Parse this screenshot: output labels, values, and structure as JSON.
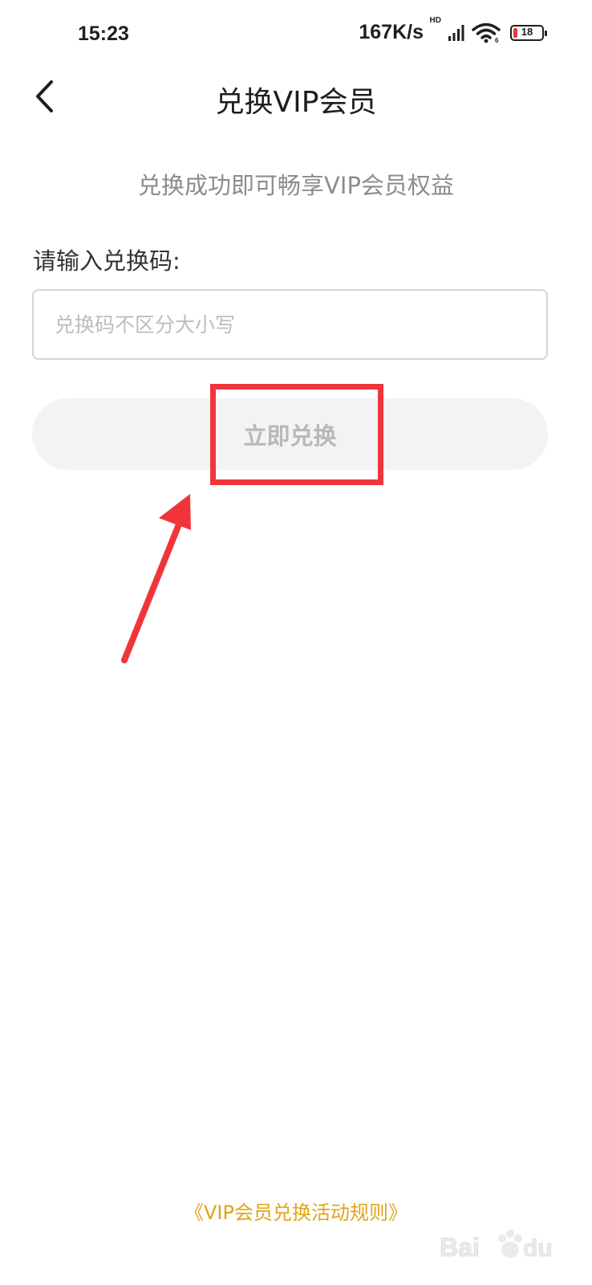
{
  "status_bar": {
    "time": "15:23",
    "net_speed": "167K/s",
    "hd_label": "HD",
    "battery_level": "18",
    "icons": [
      "signal-icon",
      "wifi-icon",
      "battery-icon"
    ]
  },
  "header": {
    "back_icon": "chevron-left-icon",
    "title": "兑换VIP会员"
  },
  "main": {
    "subtitle": "兑换成功即可畅享VIP会员权益",
    "input_label": "请输入兑换码:",
    "code_input": {
      "value": "",
      "placeholder": "兑换码不区分大小写"
    },
    "redeem_button_label": "立即兑换"
  },
  "footer": {
    "rules_link": "《VIP会员兑换活动规则》"
  },
  "colors": {
    "title": "#1e1e1e",
    "subtitle": "#8c8c8c",
    "placeholder": "#bdbdbd",
    "button_bg": "#f3f3f3",
    "button_text": "#b8b8b8",
    "rules_link": "#e0a419",
    "annotation": "#f0353a"
  }
}
